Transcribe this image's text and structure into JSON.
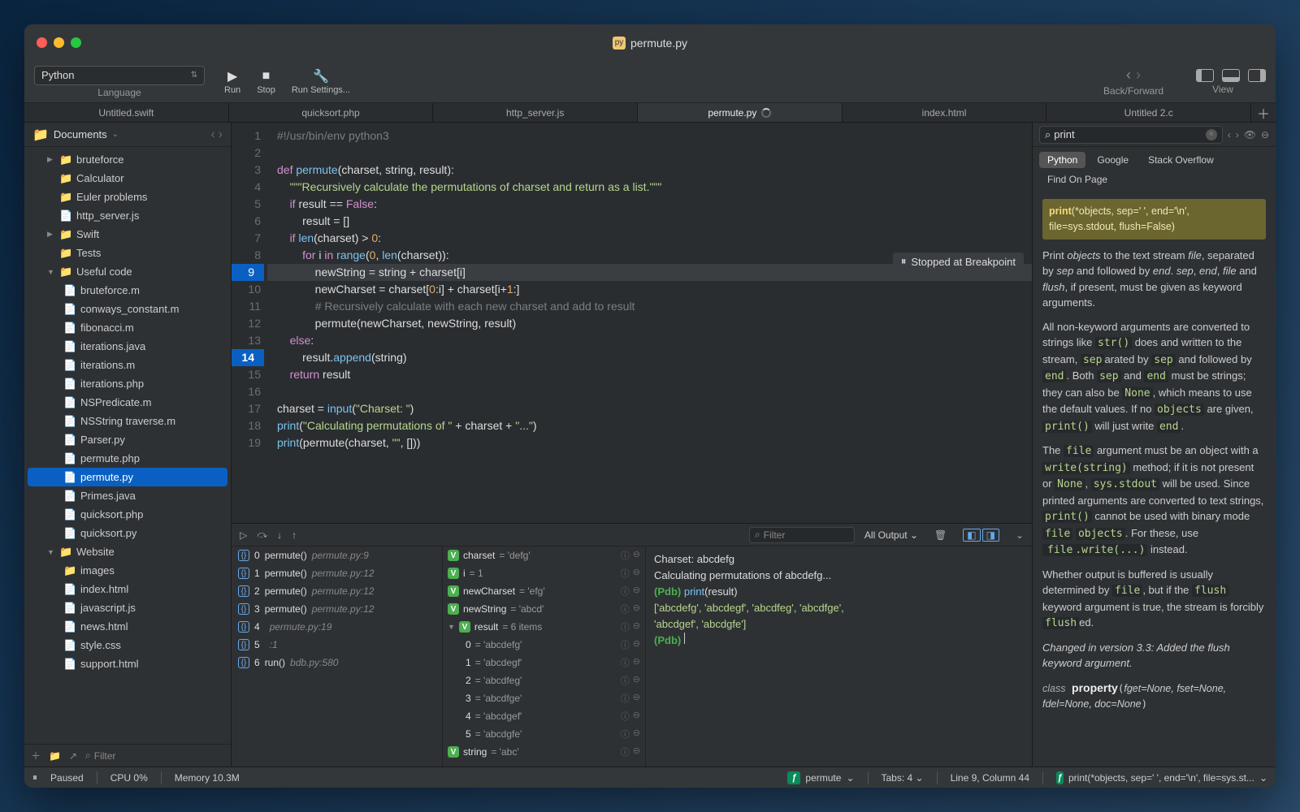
{
  "title": "permute.py",
  "toolbar": {
    "language": "Python",
    "language_label": "Language",
    "run": "Run",
    "stop": "Stop",
    "run_settings": "Run Settings...",
    "back_forward": "Back/Forward",
    "view": "View"
  },
  "tabs": [
    {
      "label": "Untitled.swift"
    },
    {
      "label": "quicksort.php"
    },
    {
      "label": "http_server.js"
    },
    {
      "label": "permute.py",
      "active": true,
      "spinner": true
    },
    {
      "label": "index.html"
    },
    {
      "label": "Untitled 2.c"
    }
  ],
  "sidebar": {
    "root": "Documents",
    "filter_placeholder": "Filter",
    "items": [
      {
        "name": "bruteforce",
        "type": "folder",
        "depth": 1,
        "disc": "▶"
      },
      {
        "name": "Calculator",
        "type": "folder",
        "depth": 1,
        "disc": ""
      },
      {
        "name": "Euler problems",
        "type": "folder",
        "depth": 1,
        "disc": ""
      },
      {
        "name": "http_server.js",
        "type": "file",
        "depth": 1,
        "disc": ""
      },
      {
        "name": "Swift",
        "type": "folder",
        "depth": 1,
        "disc": "▶"
      },
      {
        "name": "Tests",
        "type": "folder",
        "depth": 1,
        "disc": ""
      },
      {
        "name": "Useful code",
        "type": "folder",
        "depth": 1,
        "disc": "▼"
      },
      {
        "name": "bruteforce.m",
        "type": "file",
        "depth": 2
      },
      {
        "name": "conways_constant.m",
        "type": "file",
        "depth": 2
      },
      {
        "name": "fibonacci.m",
        "type": "file",
        "depth": 2
      },
      {
        "name": "iterations.java",
        "type": "file",
        "depth": 2
      },
      {
        "name": "iterations.m",
        "type": "file",
        "depth": 2
      },
      {
        "name": "iterations.php",
        "type": "file",
        "depth": 2
      },
      {
        "name": "NSPredicate.m",
        "type": "file",
        "depth": 2
      },
      {
        "name": "NSString traverse.m",
        "type": "file",
        "depth": 2
      },
      {
        "name": "Parser.py",
        "type": "file",
        "depth": 2
      },
      {
        "name": "permute.php",
        "type": "file",
        "depth": 2
      },
      {
        "name": "permute.py",
        "type": "file",
        "depth": 2,
        "selected": true
      },
      {
        "name": "Primes.java",
        "type": "file",
        "depth": 2
      },
      {
        "name": "quicksort.php",
        "type": "file",
        "depth": 2
      },
      {
        "name": "quicksort.py",
        "type": "file",
        "depth": 2
      },
      {
        "name": "Website",
        "type": "folder",
        "depth": 1,
        "disc": "▼"
      },
      {
        "name": "images",
        "type": "folder",
        "depth": 2,
        "disc": "▶"
      },
      {
        "name": "index.html",
        "type": "file",
        "depth": 2
      },
      {
        "name": "javascript.js",
        "type": "file",
        "depth": 2
      },
      {
        "name": "news.html",
        "type": "file",
        "depth": 2
      },
      {
        "name": "style.css",
        "type": "file",
        "depth": 2
      },
      {
        "name": "support.html",
        "type": "file",
        "depth": 2
      }
    ]
  },
  "editor": {
    "stopped_label": "Stopped at Breakpoint",
    "breakpoint_line": 9,
    "pc_line": 14,
    "line_count": 19
  },
  "debug": {
    "filter_placeholder": "Filter",
    "output_selector": "All Output",
    "stack": [
      {
        "idx": "0",
        "fn": "permute()",
        "loc": "permute.py:9"
      },
      {
        "idx": "1",
        "fn": "permute()",
        "loc": "permute.py:12"
      },
      {
        "idx": "2",
        "fn": "permute()",
        "loc": "permute.py:12"
      },
      {
        "idx": "3",
        "fn": "permute()",
        "loc": "permute.py:12"
      },
      {
        "idx": "4",
        "fn": "",
        "loc": "permute.py:19"
      },
      {
        "idx": "5",
        "fn": "",
        "loc": "<string>:1"
      },
      {
        "idx": "6",
        "fn": "run()",
        "loc": "bdb.py:580"
      }
    ],
    "vars": [
      {
        "badge": "V",
        "name": "charset",
        "value": "= 'defg'"
      },
      {
        "badge": "V",
        "name": "i",
        "value": "= 1"
      },
      {
        "badge": "V",
        "name": "newCharset",
        "value": "= 'efg'"
      },
      {
        "badge": "V",
        "name": "newString",
        "value": "= 'abcd'"
      },
      {
        "badge": "V",
        "name": "result",
        "value": "= 6 items",
        "expandable": true
      },
      {
        "badge": "",
        "name": "0",
        "value": "= 'abcdefg'",
        "indent": true
      },
      {
        "badge": "",
        "name": "1",
        "value": "= 'abcdegf'",
        "indent": true
      },
      {
        "badge": "",
        "name": "2",
        "value": "= 'abcdfeg'",
        "indent": true
      },
      {
        "badge": "",
        "name": "3",
        "value": "= 'abcdfge'",
        "indent": true
      },
      {
        "badge": "",
        "name": "4",
        "value": "= 'abcdgef'",
        "indent": true
      },
      {
        "badge": "",
        "name": "5",
        "value": "= 'abcdgfe'",
        "indent": true
      },
      {
        "badge": "V",
        "name": "string",
        "value": "= 'abc'"
      }
    ],
    "console": {
      "l1": "Charset: abcdefg",
      "l2": "Calculating permutations of abcdefg...",
      "l3_pdb": "(Pdb)",
      "l3_cmd": "print",
      "l3_arg": "(result)",
      "l4": "['abcdefg', 'abcdegf', 'abcdfeg', 'abcdfge',",
      "l5": "   'abcdgef', 'abcdgfe']",
      "l6_pdb": "(Pdb)"
    }
  },
  "docs": {
    "search_value": "print",
    "tabs": [
      "Python",
      "Google",
      "Stack Overflow",
      "Find On Page"
    ],
    "active_tab": 0,
    "signature_fn": "print",
    "signature_args": "(*objects, sep=' ', end='\\n', file=sys.stdout, flush=False)",
    "p1a": "Print ",
    "p1b": "objects",
    "p1c": " to the text stream ",
    "p1d": "file",
    "p1e": ", separated by ",
    "p1f": "sep",
    "p1g": " and followed by ",
    "p1h": "end",
    "p1i": ". ",
    "p1j": "sep",
    "p1k": ", ",
    "p1l": "end",
    "p1m": ", ",
    "p1n": "file",
    "p1o": " and ",
    "p1p": "flush",
    "p1q": ", if present, must be given as keyword arguments.",
    "p2": "All non-keyword arguments are converted to strings like str() does and written to the stream, separated by sep and followed by end. Both sep and end must be strings; they can also be None, which means to use the default values. If no objects are given, print() will just write end.",
    "p3": "The file argument must be an object with a write(string) method; if it is not present or None, sys.stdout will be used. Since printed arguments are converted to text strings, print() cannot be used with binary mode file objects. For these, use file.write(...) instead.",
    "p4": "Whether output is buffered is usually determined by file, but if the flush keyword argument is true, the stream is forcibly flushed.",
    "p5": "Changed in version 3.3: Added the flush keyword argument.",
    "class_kw": "class",
    "class_name": "property",
    "class_args": "(fget=None, fset=None, fdel=None, doc=None)"
  },
  "status": {
    "paused": "Paused",
    "cpu": "CPU 0%",
    "memory": "Memory 10.3M",
    "fn": "permute",
    "tabs": "Tabs: 4",
    "position": "Line 9, Column 44",
    "doc_hint": "print(*objects, sep=' ', end='\\n', file=sys.st..."
  }
}
